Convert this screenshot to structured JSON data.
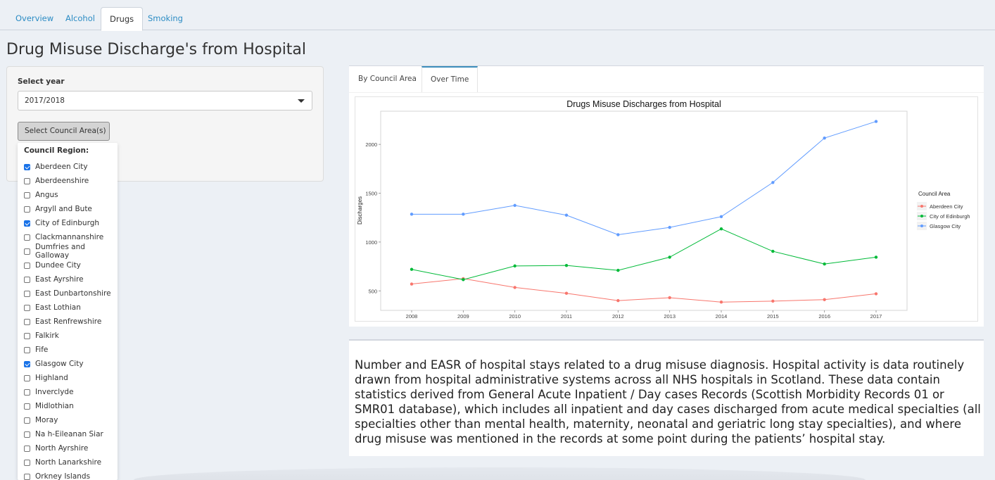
{
  "nav": {
    "tabs": [
      "Overview",
      "Alcohol",
      "Drugs",
      "Smoking"
    ],
    "active": "Drugs"
  },
  "page": {
    "title": "Drug Misuse Discharge's from Hospital"
  },
  "sidebar": {
    "year_label": "Select year",
    "year_value": "2017/2018",
    "council_button": "Select Council Area(s)",
    "dropdown_heading": "Council Region:",
    "options": [
      {
        "label": "Aberdeen City",
        "checked": true
      },
      {
        "label": "Aberdeenshire",
        "checked": false
      },
      {
        "label": "Angus",
        "checked": false
      },
      {
        "label": "Argyll and Bute",
        "checked": false
      },
      {
        "label": "City of Edinburgh",
        "checked": true
      },
      {
        "label": "Clackmannanshire",
        "checked": false
      },
      {
        "label": "Dumfries and Galloway",
        "checked": false
      },
      {
        "label": "Dundee City",
        "checked": false
      },
      {
        "label": "East Ayrshire",
        "checked": false
      },
      {
        "label": "East Dunbartonshire",
        "checked": false
      },
      {
        "label": "East Lothian",
        "checked": false
      },
      {
        "label": "East Renfrewshire",
        "checked": false
      },
      {
        "label": "Falkirk",
        "checked": false
      },
      {
        "label": "Fife",
        "checked": false
      },
      {
        "label": "Glasgow City",
        "checked": true
      },
      {
        "label": "Highland",
        "checked": false
      },
      {
        "label": "Inverclyde",
        "checked": false
      },
      {
        "label": "Midlothian",
        "checked": false
      },
      {
        "label": "Moray",
        "checked": false
      },
      {
        "label": "Na h-Eileanan Siar",
        "checked": false
      },
      {
        "label": "North Ayrshire",
        "checked": false
      },
      {
        "label": "North Lanarkshire",
        "checked": false
      },
      {
        "label": "Orkney Islands",
        "checked": false
      }
    ]
  },
  "chart_tabs": {
    "tabs": [
      "By Council Area",
      "Over Time"
    ],
    "active": "Over Time"
  },
  "chart_data": {
    "type": "line",
    "title": "Drugs Misuse Discharges from Hospital",
    "xlabel": "",
    "ylabel": "Discharges",
    "x": [
      2008,
      2009,
      2010,
      2011,
      2012,
      2013,
      2014,
      2015,
      2016,
      2017
    ],
    "xlim": [
      2007.4,
      2017.6
    ],
    "ylim": [
      300,
      2340
    ],
    "yticks": [
      500,
      1000,
      1500,
      2000
    ],
    "legend_title": "Council Area",
    "legend_position": "right",
    "grid": false,
    "series": [
      {
        "name": "Aberdeen City",
        "color": "#f8766d",
        "values": [
          570,
          625,
          535,
          475,
          400,
          430,
          385,
          395,
          410,
          470
        ]
      },
      {
        "name": "City of Edinburgh",
        "color": "#00ba38",
        "values": [
          720,
          615,
          755,
          760,
          710,
          845,
          1135,
          905,
          775,
          845
        ]
      },
      {
        "name": "Glasgow City",
        "color": "#619cff",
        "values": [
          1285,
          1285,
          1375,
          1275,
          1075,
          1150,
          1260,
          1610,
          2065,
          2235
        ]
      }
    ]
  },
  "description": {
    "text": "Number and EASR of hospital stays related to a drug misuse diagnosis. Hospital activity is data routinely drawn from hospital administrative systems across all NHS hospitals in Scotland. These data contain statistics derived from General Acute Inpatient / Day cases Records (Scottish Morbidity Records 01 or SMR01 database), which includes all inpatient and day cases discharged from acute medical specialties (all specialties other than mental health, maternity, neonatal and geriatric long stay specialties), and where drug misuse was mentioned in the records at some point during the patients’ hospital stay."
  }
}
